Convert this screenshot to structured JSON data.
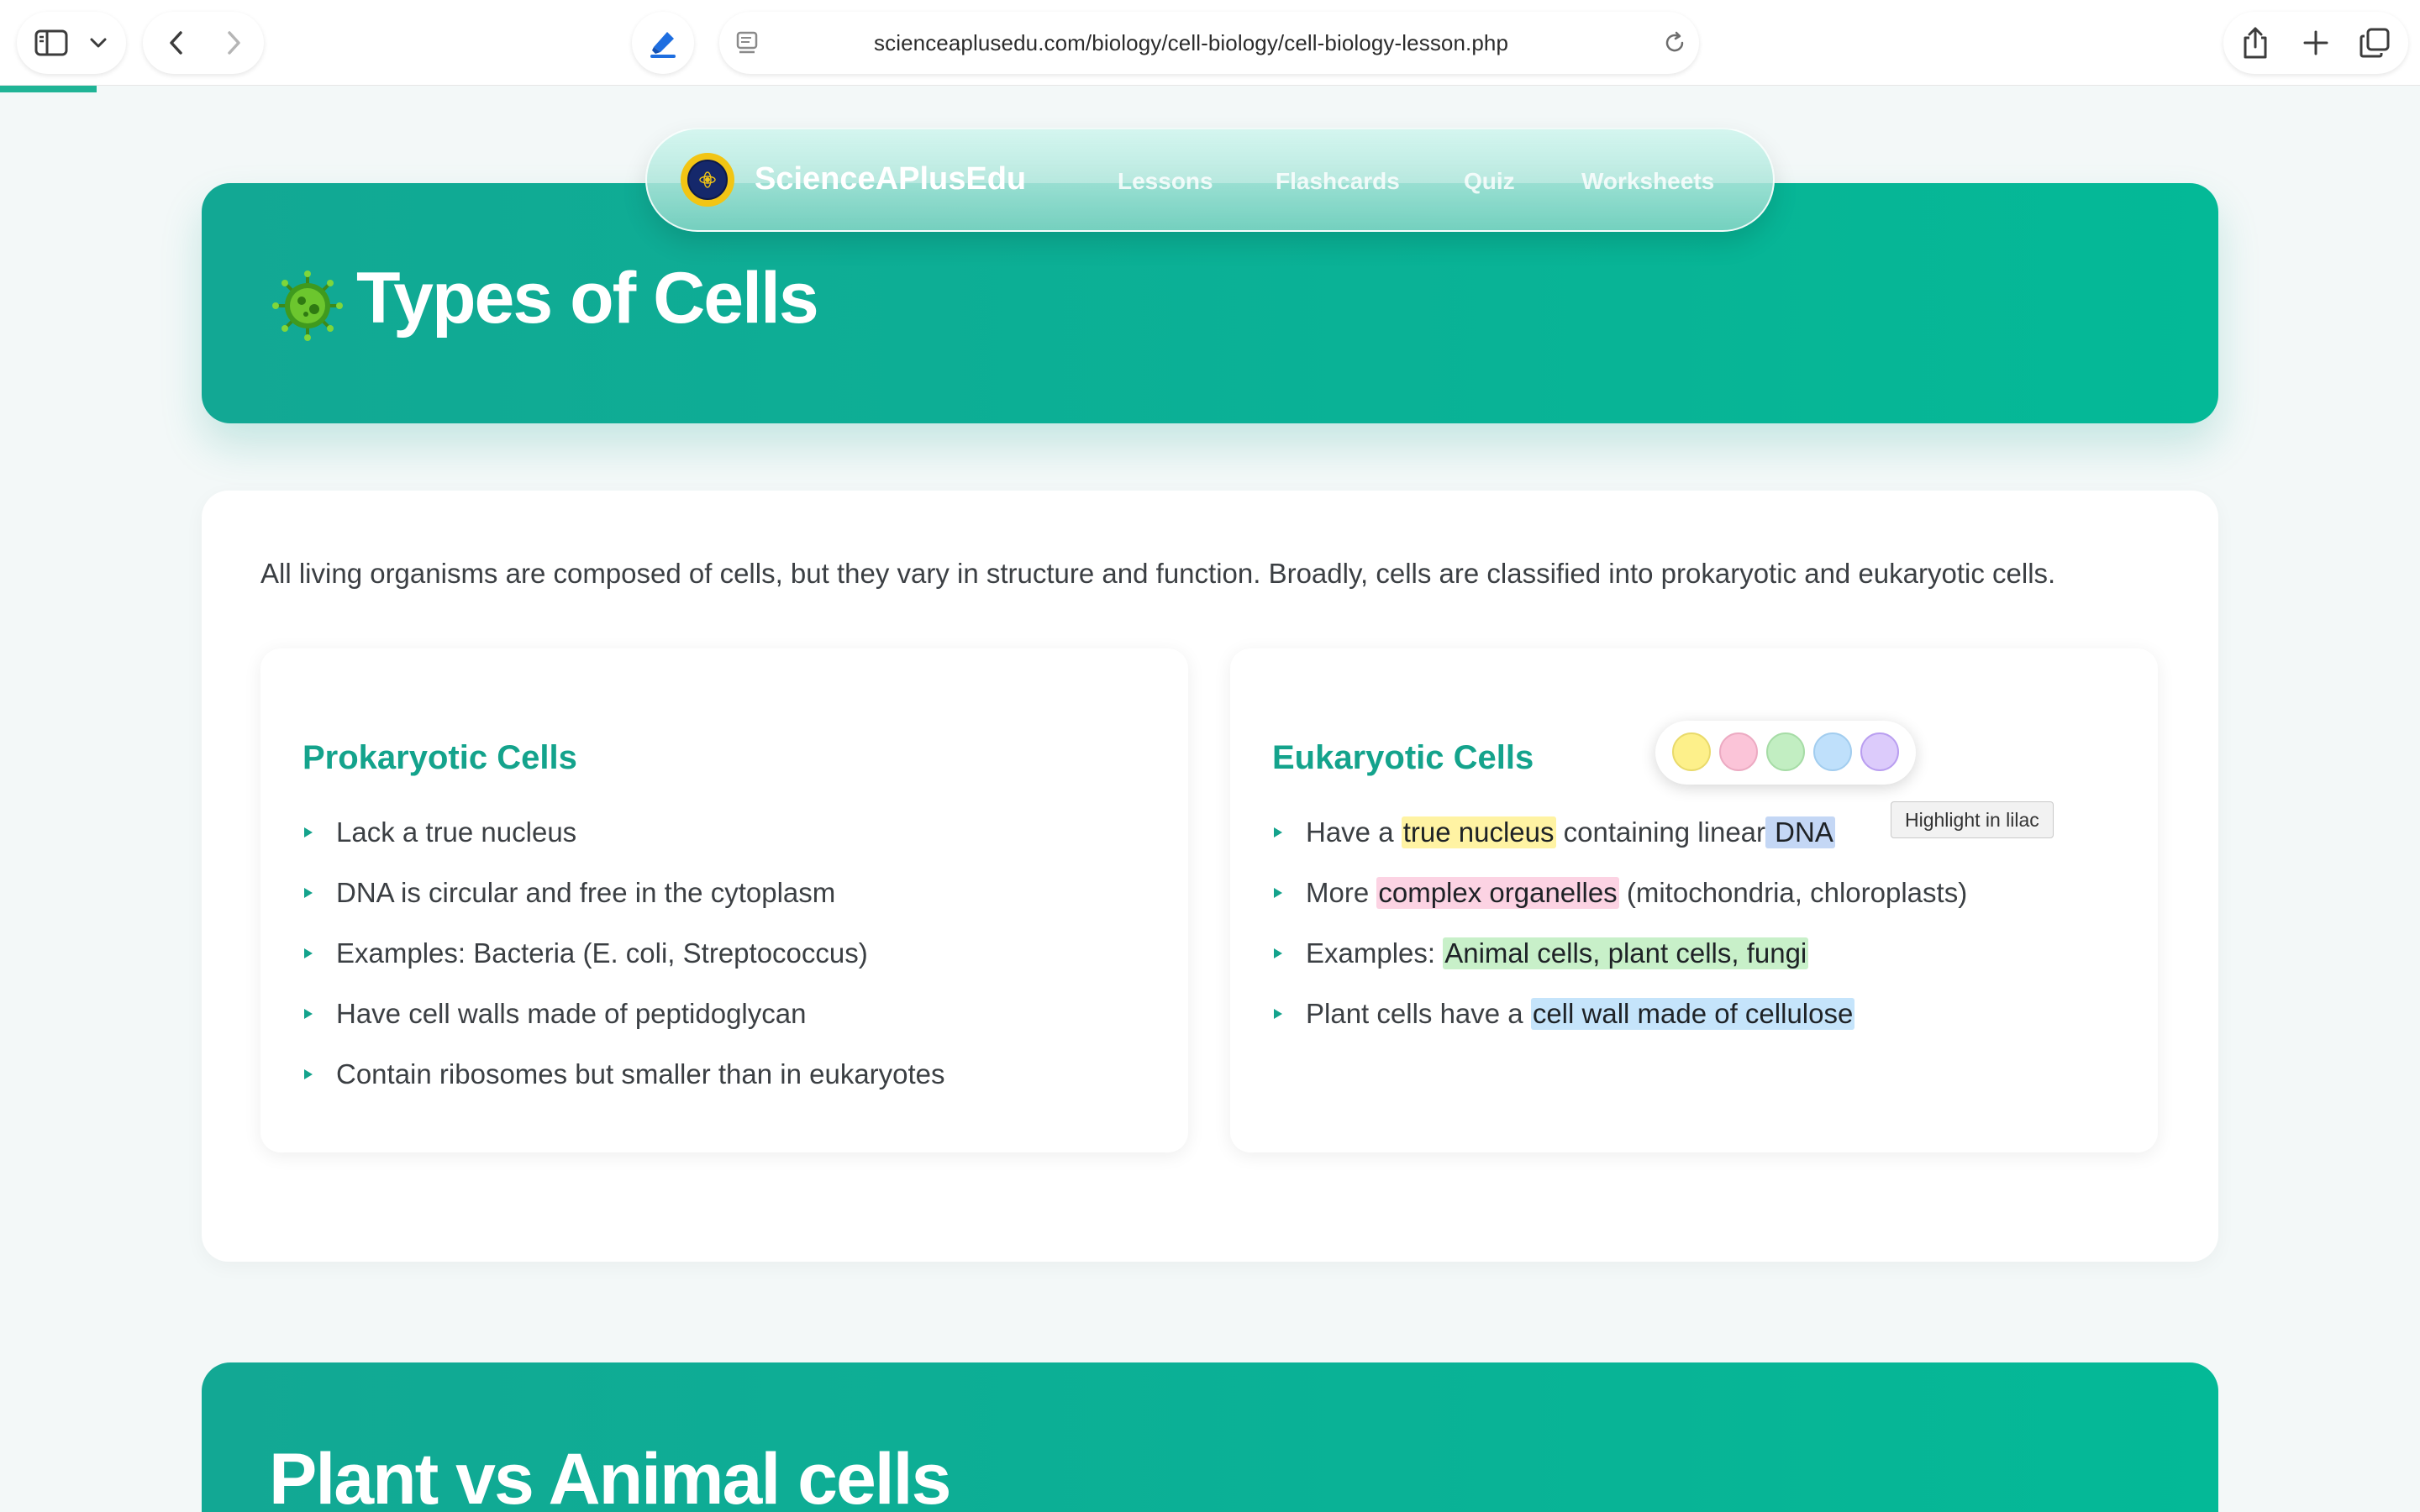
{
  "browser": {
    "url": "scienceaplusedu.com/biology/cell-biology/cell-biology-lesson.php",
    "load_progress_percent": 4
  },
  "site": {
    "brand": "ScienceAPlusEdu",
    "nav": [
      "Lessons",
      "Flashcards",
      "Quiz",
      "Worksheets"
    ]
  },
  "hero": {
    "title": "Types of Cells"
  },
  "intro": "All living organisms are composed of cells, but they vary in structure and function. Broadly, cells are classified into prokaryotic and eukaryotic cells.",
  "prokaryotic": {
    "title": "Prokaryotic Cells",
    "items": [
      "Lack a true nucleus",
      "DNA is circular and free in the cytoplasm",
      "Examples: Bacteria (E. coli, Streptococcus)",
      "Have cell walls made of peptidoglycan",
      "Contain ribosomes but smaller than in eukaryotes"
    ]
  },
  "eukaryotic": {
    "title": "Eukaryotic Cells",
    "item1": {
      "pre": "Have a ",
      "hl": "true nucleus",
      "mid": " containing linear",
      "sel": " DNA"
    },
    "item2": {
      "pre": "More ",
      "hl": "complex organelles",
      "post": " (mitochondria, chloroplasts)"
    },
    "item3": {
      "pre": "Examples: ",
      "hl": "Animal cells, plant cells, fungi"
    },
    "item4": {
      "pre": "Plant cells have a ",
      "hl": "cell wall made of cellulose"
    }
  },
  "highlighter": {
    "colors": [
      {
        "name": "yellow",
        "hex": "#fdf08a"
      },
      {
        "name": "pink",
        "hex": "#fbc4d8"
      },
      {
        "name": "green",
        "hex": "#c2eec2"
      },
      {
        "name": "blue",
        "hex": "#bfe0fb"
      },
      {
        "name": "lilac",
        "hex": "#dccbfb"
      }
    ],
    "tooltip": "Highlight in lilac"
  },
  "section2": {
    "title": "Plant vs Animal cells"
  },
  "colors": {
    "accent": "#14a38c",
    "hero_gradient_start": "#12a894",
    "hero_gradient_end": "#04b997"
  }
}
